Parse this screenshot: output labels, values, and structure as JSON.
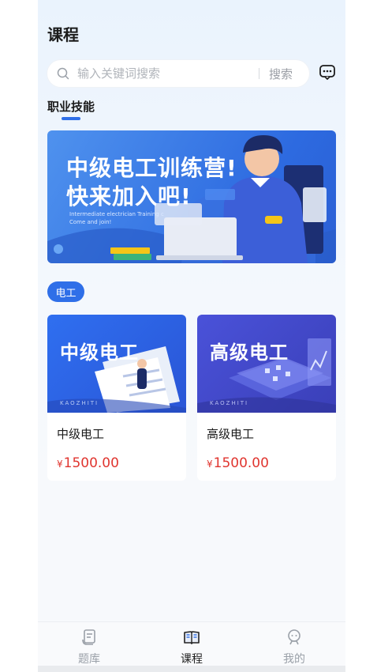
{
  "header": {
    "title": "课程"
  },
  "search": {
    "placeholder": "输入关键词搜索",
    "button": "搜索"
  },
  "section": {
    "title": "职业技能"
  },
  "banner": {
    "title_line1": "中级电工训练营!",
    "title_line2": "快来加入吧!",
    "subtitle_line1": "Intermediate electrician Training c",
    "subtitle_line2": "Come and join!"
  },
  "category_tag": "电工",
  "courses": [
    {
      "image_title": "中级电工",
      "watermark": "KAOZHITI",
      "name": "中级电工",
      "currency": "¥",
      "price": "1500.00"
    },
    {
      "image_title": "高级电工",
      "watermark": "KAOZHITI",
      "name": "高级电工",
      "currency": "¥",
      "price": "1500.00"
    }
  ],
  "tabbar": {
    "items": [
      {
        "label": "题库",
        "icon": "question-bank-icon",
        "active": false
      },
      {
        "label": "课程",
        "icon": "book-icon",
        "active": true
      },
      {
        "label": "我的",
        "icon": "profile-icon",
        "active": false
      }
    ]
  },
  "colors": {
    "accent": "#2f6fe8",
    "price": "#e0352f"
  }
}
